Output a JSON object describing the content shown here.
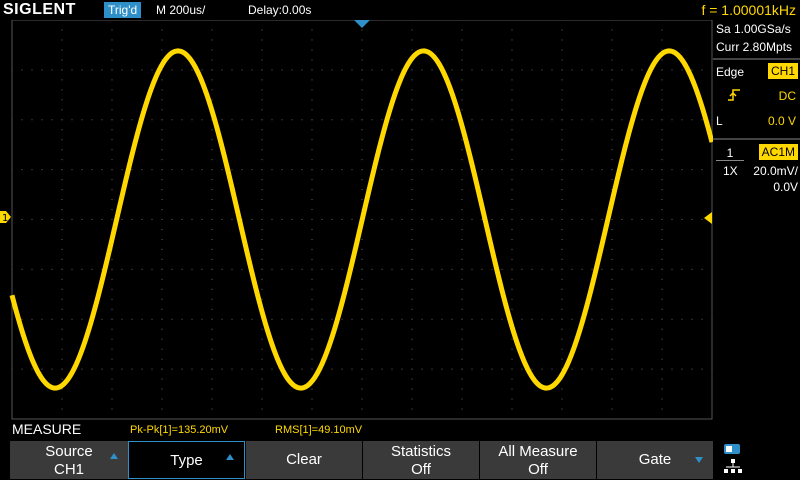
{
  "topbar": {
    "brand": "SIGLENT",
    "trigger_status": "Trig'd",
    "timebase": "M 200us/",
    "delay": "Delay:0.00s",
    "frequency": "f = 1.00001kHz"
  },
  "acquisition": {
    "sample_rate": "Sa 1.00GSa/s",
    "memory_depth": "Curr 2.80Mpts"
  },
  "trigger": {
    "type": "Edge",
    "source": "CH1",
    "slope_icon": "rising-edge-icon",
    "coupling": "DC",
    "level_label": "L",
    "level_value": "0.0 V"
  },
  "channel1": {
    "number": "1",
    "coupling": "AC1M",
    "probe": "1X",
    "scale": "20.0mV/",
    "offset": "0.0V",
    "marker": "1",
    "color": "#ffd800"
  },
  "measure": {
    "title": "MEASURE",
    "pkpk": "Pk-Pk[1]=135.20mV",
    "rms": "RMS[1]=49.10mV"
  },
  "softkeys": {
    "source_l1": "Source",
    "source_l2": "CH1",
    "type": "Type",
    "clear": "Clear",
    "statistics_l1": "Statistics",
    "statistics_l2": "Off",
    "all_measure_l1": "All Measure",
    "all_measure_l2": "Off",
    "gate": "Gate"
  },
  "waveform": {
    "cycles_visible": 2.85,
    "frequency_hz": 1000.01,
    "pkpk_mv": 135.2,
    "vertical_scale_mv_per_div": 20.0
  },
  "colors": {
    "accent": "#2f8fc8",
    "trace": "#ffd800",
    "softkey_bg": "#3a3a3a"
  }
}
